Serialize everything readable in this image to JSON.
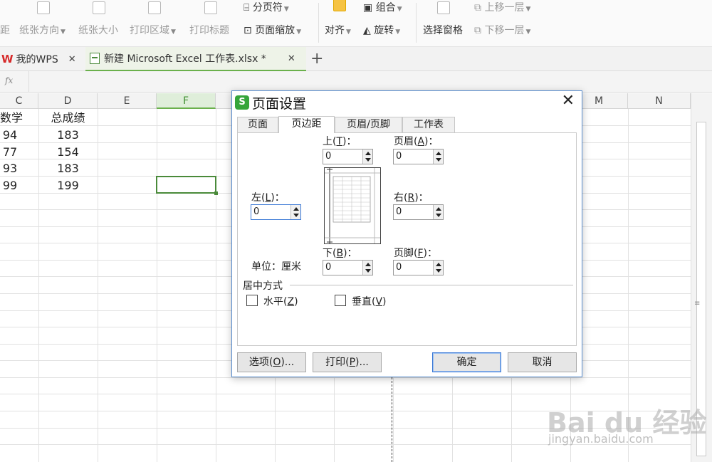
{
  "ribbon": {
    "row1": {
      "page_break": "分页符",
      "group": "组合",
      "bring_forward": "上移一层"
    },
    "row2": {
      "margins": "距",
      "orientation": "纸张方向",
      "size": "纸张大小",
      "print_area": "打印区域",
      "print_titles": "打印标题",
      "page_scale": "页面缩放",
      "align": "对齐",
      "rotate": "旋转",
      "selection_pane": "选择窗格",
      "send_backward": "下移一层"
    }
  },
  "tabs": [
    {
      "label": "我的WPS",
      "logo": "W"
    },
    {
      "label": "新建 Microsoft Excel 工作表.xlsx *"
    }
  ],
  "formula_bar": {
    "fx": "fx"
  },
  "sheet": {
    "columns": [
      "C",
      "D",
      "E",
      "F",
      "",
      "",
      "",
      "",
      "M",
      "N"
    ],
    "selected_column": "F",
    "header_row": [
      "数学",
      "总成绩"
    ],
    "rows": [
      [
        "94",
        "183"
      ],
      [
        "77",
        "154"
      ],
      [
        "93",
        "183"
      ],
      [
        "99",
        "199"
      ]
    ]
  },
  "dialog": {
    "title": "页面设置",
    "icon_letter": "S",
    "tabs": [
      "页面",
      "页边距",
      "页眉/页脚",
      "工作表"
    ],
    "active_tab": "页边距",
    "fields": {
      "top": {
        "label": "上",
        "key": "T",
        "value": "0"
      },
      "header": {
        "label": "页眉",
        "key": "A",
        "value": "0"
      },
      "left": {
        "label": "左",
        "key": "L",
        "value": "0"
      },
      "right": {
        "label": "右",
        "key": "R",
        "value": "0"
      },
      "bottom": {
        "label": "下",
        "key": "B",
        "value": "0"
      },
      "footer": {
        "label": "页脚",
        "key": "F",
        "value": "0"
      }
    },
    "unit_label": "单位：厘米",
    "center_group": "居中方式",
    "horizontal": {
      "label": "水平",
      "key": "Z"
    },
    "vertical": {
      "label": "垂直",
      "key": "V"
    },
    "buttons": {
      "options": {
        "label": "选项",
        "key": "O"
      },
      "print": {
        "label": "打印",
        "key": "P"
      },
      "ok": "确定",
      "cancel": "取消"
    }
  },
  "watermark": {
    "main": "Bai du 经验",
    "sub": "jingyan.baidu.com"
  },
  "colors": {
    "accent": "#6ab04c",
    "dialog_border": "#5a8ecf",
    "wps_red": "#d62828"
  }
}
